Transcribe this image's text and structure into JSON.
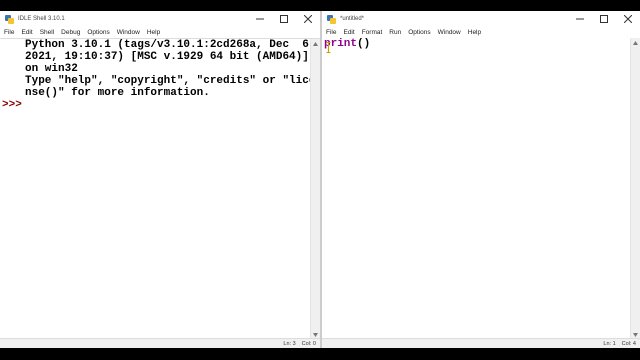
{
  "shell": {
    "title": "IDLE Shell 3.10.1",
    "menu": [
      "File",
      "Edit",
      "Shell",
      "Debug",
      "Options",
      "Window",
      "Help"
    ],
    "banner": [
      "Python 3.10.1 (tags/v3.10.1:2cd268a, Dec  6",
      "2021, 19:10:37) [MSC v.1929 64 bit (AMD64)]",
      "on win32",
      "Type \"help\", \"copyright\", \"credits\" or \"lice",
      "nse()\" for more information."
    ],
    "prompt": ">>>",
    "status_line": "Ln: 3",
    "status_col": "Col: 0"
  },
  "editor": {
    "title": "*untitled*",
    "menu": [
      "File",
      "Edit",
      "Format",
      "Run",
      "Options",
      "Window",
      "Help"
    ],
    "code_keyword": "print",
    "code_rest": "()",
    "status_line": "Ln: 1",
    "status_col": "Col: 4"
  },
  "colors": {
    "keyword": "#900090",
    "prompt": "#8b0000"
  }
}
